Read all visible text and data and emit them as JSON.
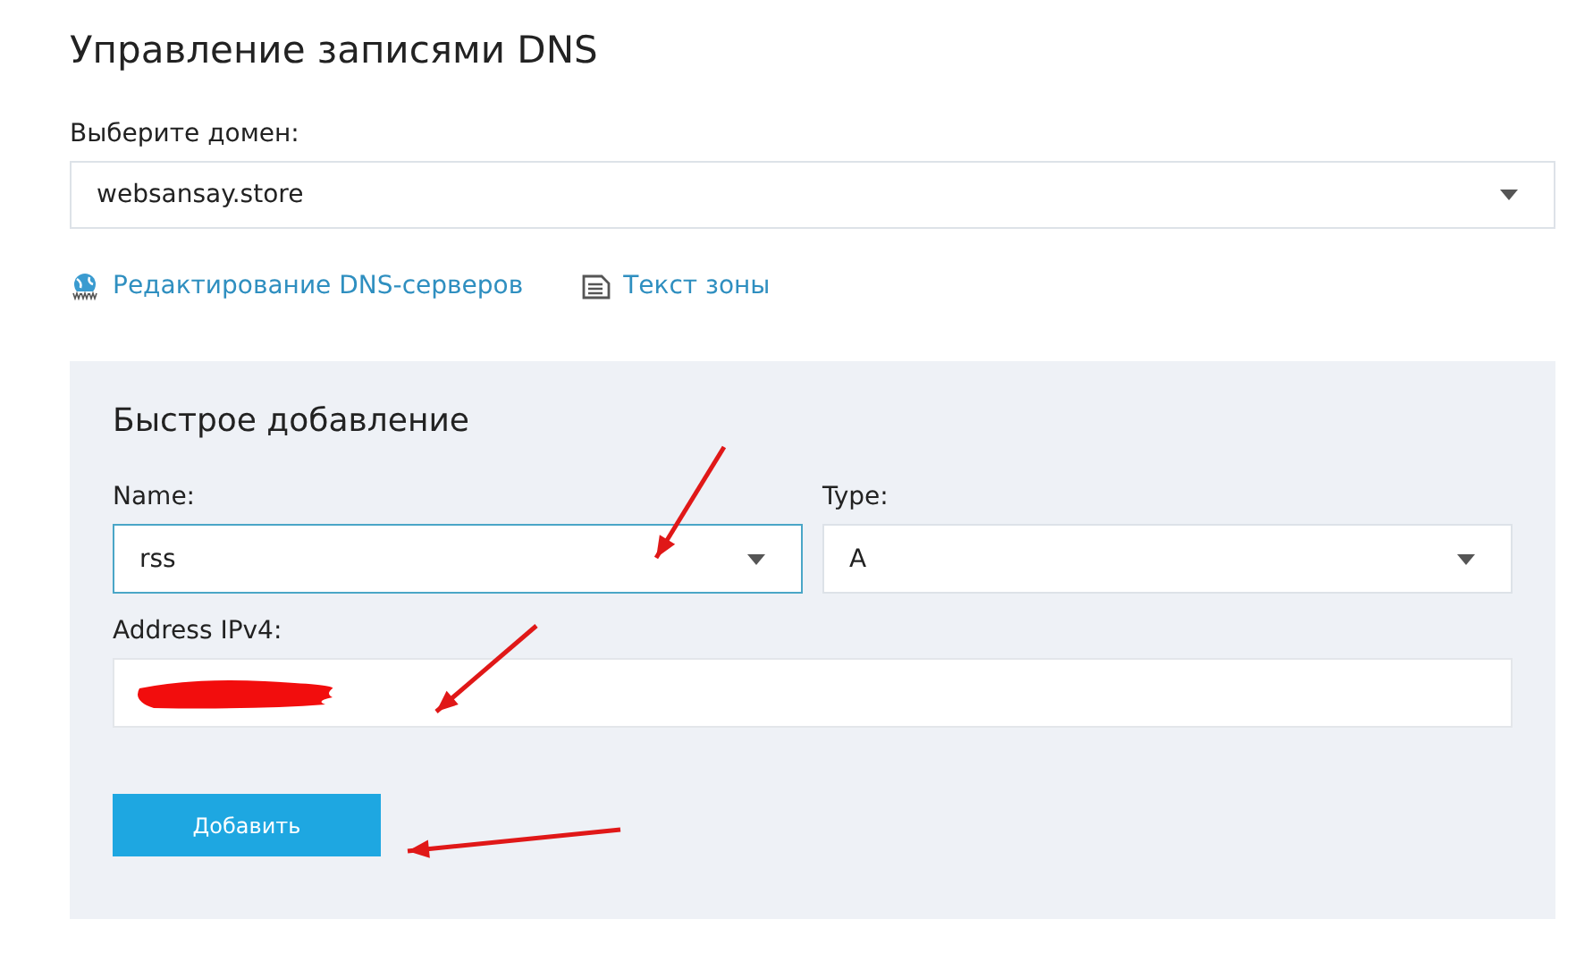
{
  "title": "Управление записями DNS",
  "domain": {
    "label": "Выберите домен:",
    "value": "websansay.store"
  },
  "links": [
    {
      "kind": "globe",
      "label": "Редактирование DNS-серверов"
    },
    {
      "kind": "document",
      "label": "Текст зоны"
    }
  ],
  "quick_add": {
    "title": "Быстрое добавление",
    "name": {
      "label": "Name:",
      "value": "rss",
      "focused": true
    },
    "type": {
      "label": "Type:",
      "value": "A",
      "focused": false
    },
    "address": {
      "label": "Address IPv4:",
      "redacted": true
    },
    "button": "Добавить"
  }
}
